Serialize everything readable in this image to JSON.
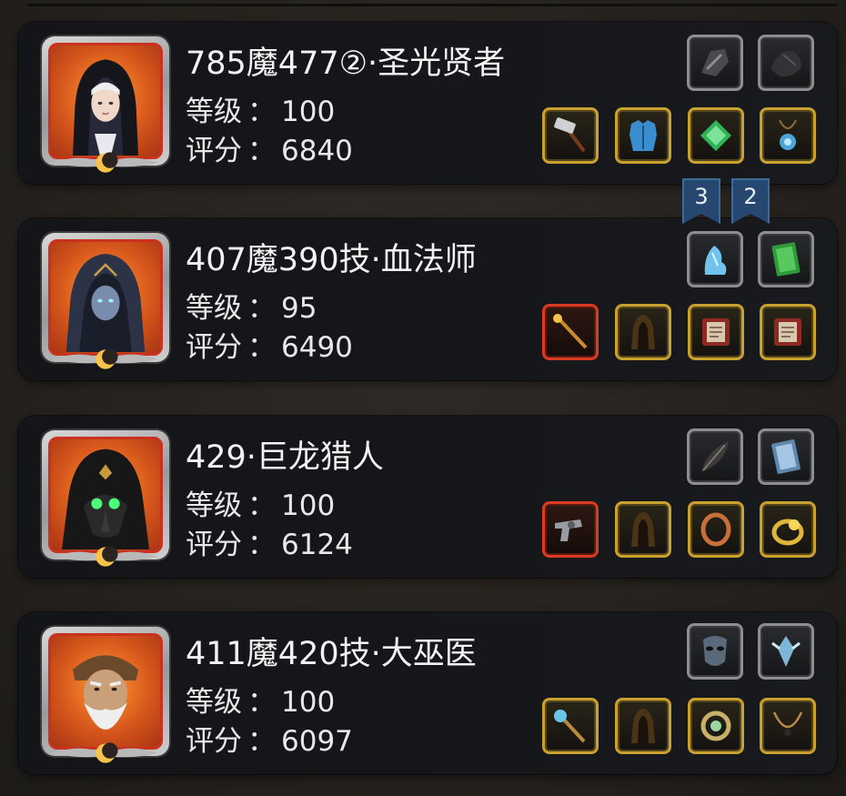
{
  "characters": [
    {
      "name": "785魔477②·圣光贤者",
      "level_label": "等级",
      "level": "100",
      "score_label": "评分",
      "score": "6840",
      "portrait": "nun-portrait",
      "equipment": [
        {
          "icon": "dark-gauntlet-icon",
          "frame": "gray"
        },
        {
          "icon": "black-claw-icon",
          "frame": "gray"
        },
        {
          "icon": "war-hammer-icon",
          "frame": "gold"
        },
        {
          "icon": "blue-chest-armor-icon",
          "frame": "gold"
        },
        {
          "icon": "green-gem-icon",
          "frame": "gold"
        },
        {
          "icon": "amulet-icon",
          "frame": "gold"
        }
      ]
    },
    {
      "name": "407魔390技·血法师",
      "level_label": "等级",
      "level": "95",
      "score_label": "评分",
      "score": "6490",
      "portrait": "hooded-mage-portrait",
      "equipment": [
        {
          "icon": "ice-figure-icon",
          "frame": "gray"
        },
        {
          "icon": "green-tome-icon",
          "frame": "gray"
        },
        {
          "icon": "golden-staff-icon",
          "frame": "red"
        },
        {
          "icon": "hooded-cloak-icon",
          "frame": "gold"
        },
        {
          "icon": "red-spellbook-icon",
          "frame": "gold"
        },
        {
          "icon": "red-spellbook-icon",
          "frame": "gold"
        }
      ]
    },
    {
      "name": "429·巨龙猎人",
      "level_label": "等级",
      "level": "100",
      "score_label": "评分",
      "score": "6124",
      "portrait": "plague-hunter-portrait",
      "equipment": [
        {
          "icon": "dark-feather-icon",
          "frame": "gray"
        },
        {
          "icon": "blue-book-icon",
          "frame": "gray"
        },
        {
          "icon": "revolver-icon",
          "frame": "red"
        },
        {
          "icon": "hooded-cloak-icon",
          "frame": "gold"
        },
        {
          "icon": "bronze-ring-icon",
          "frame": "gold"
        },
        {
          "icon": "gold-ring-icon",
          "frame": "gold"
        }
      ]
    },
    {
      "name": "411魔420技·大巫医",
      "level_label": "等级",
      "level": "100",
      "score_label": "评分",
      "score": "6097",
      "portrait": "shaman-elder-portrait",
      "equipment": [
        {
          "icon": "stone-mask-icon",
          "frame": "gray"
        },
        {
          "icon": "crystal-emblem-icon",
          "frame": "gray"
        },
        {
          "icon": "orb-scepter-icon",
          "frame": "gold"
        },
        {
          "icon": "hooded-cloak-icon",
          "frame": "gold"
        },
        {
          "icon": "ornate-ring-icon",
          "frame": "gold"
        },
        {
          "icon": "necklace-icon",
          "frame": "gold"
        }
      ]
    }
  ],
  "flags": [
    "3",
    "2"
  ],
  "colors": {
    "panel": "#141518",
    "portrait_frame_red": "#c8321e",
    "slot_gray": "#8e8e8e",
    "slot_gold": "#c8a12e",
    "slot_red": "#d83a22",
    "flag_blue": "#26476f"
  }
}
